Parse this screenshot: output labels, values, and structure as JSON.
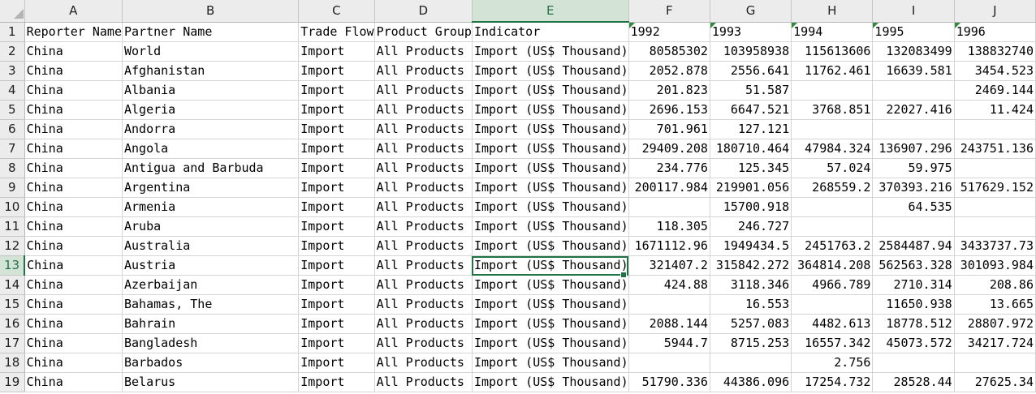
{
  "columns": [
    "A",
    "B",
    "C",
    "D",
    "E",
    "F",
    "G",
    "H",
    "I",
    "J"
  ],
  "selected_column": "E",
  "selected_row": "13",
  "rows": [
    {
      "n": "1",
      "a": "Reporter Name",
      "b": "Partner Name",
      "c": "Trade Flow",
      "d": "Product Group",
      "e": "Indicator",
      "f": "1992",
      "g": "1993",
      "h": "1994",
      "i": "1995",
      "j": "1996"
    },
    {
      "n": "2",
      "a": "China",
      "b": " World",
      "c": "Import",
      "d": " All Products",
      "e": "Import (US$ Thousand)",
      "f": "80585302",
      "g": "103958938",
      "h": "115613606",
      "i": "132083499",
      "j": "138832740"
    },
    {
      "n": "3",
      "a": "China",
      "b": "Afghanistan",
      "c": "Import",
      "d": " All Products",
      "e": "Import (US$ Thousand)",
      "f": "2052.878",
      "g": "2556.641",
      "h": "11762.461",
      "i": "16639.581",
      "j": "3454.523"
    },
    {
      "n": "4",
      "a": "China",
      "b": "Albania",
      "c": "Import",
      "d": " All Products",
      "e": "Import (US$ Thousand)",
      "f": "201.823",
      "g": "51.587",
      "h": "",
      "i": "",
      "j": "2469.144"
    },
    {
      "n": "5",
      "a": "China",
      "b": "Algeria",
      "c": "Import",
      "d": " All Products",
      "e": "Import (US$ Thousand)",
      "f": "2696.153",
      "g": "6647.521",
      "h": "3768.851",
      "i": "22027.416",
      "j": "11.424"
    },
    {
      "n": "6",
      "a": "China",
      "b": "Andorra",
      "c": "Import",
      "d": " All Products",
      "e": "Import (US$ Thousand)",
      "f": "701.961",
      "g": "127.121",
      "h": "",
      "i": "",
      "j": ""
    },
    {
      "n": "7",
      "a": "China",
      "b": "Angola",
      "c": "Import",
      "d": " All Products",
      "e": "Import (US$ Thousand)",
      "f": "29409.208",
      "g": "180710.464",
      "h": "47984.324",
      "i": "136907.296",
      "j": "243751.136"
    },
    {
      "n": "8",
      "a": "China",
      "b": "Antigua and Barbuda",
      "c": "Import",
      "d": " All Products",
      "e": "Import (US$ Thousand)",
      "f": "234.776",
      "g": "125.345",
      "h": "57.024",
      "i": "59.975",
      "j": ""
    },
    {
      "n": "9",
      "a": "China",
      "b": "Argentina",
      "c": "Import",
      "d": " All Products",
      "e": "Import (US$ Thousand)",
      "f": "200117.984",
      "g": "219901.056",
      "h": "268559.2",
      "i": "370393.216",
      "j": "517629.152"
    },
    {
      "n": "10",
      "a": "China",
      "b": "Armenia",
      "c": "Import",
      "d": " All Products",
      "e": "Import (US$ Thousand)",
      "f": "",
      "g": "15700.918",
      "h": "",
      "i": "64.535",
      "j": ""
    },
    {
      "n": "11",
      "a": "China",
      "b": "Aruba",
      "c": "Import",
      "d": " All Products",
      "e": "Import (US$ Thousand)",
      "f": "118.305",
      "g": "246.727",
      "h": "",
      "i": "",
      "j": ""
    },
    {
      "n": "12",
      "a": "China",
      "b": "Australia",
      "c": "Import",
      "d": " All Products",
      "e": "Import (US$ Thousand)",
      "f": "1671112.96",
      "g": "1949434.5",
      "h": "2451763.2",
      "i": "2584487.94",
      "j": "3433737.73"
    },
    {
      "n": "13",
      "a": "China",
      "b": "Austria",
      "c": "Import",
      "d": " All Products",
      "e": "Import (US$ Thousand)",
      "f": "321407.2",
      "g": "315842.272",
      "h": "364814.208",
      "i": "562563.328",
      "j": "301093.984"
    },
    {
      "n": "14",
      "a": "China",
      "b": "Azerbaijan",
      "c": "Import",
      "d": " All Products",
      "e": "Import (US$ Thousand)",
      "f": "424.88",
      "g": "3118.346",
      "h": "4966.789",
      "i": "2710.314",
      "j": "208.86"
    },
    {
      "n": "15",
      "a": "China",
      "b": "Bahamas, The",
      "c": "Import",
      "d": " All Products",
      "e": "Import (US$ Thousand)",
      "f": "",
      "g": "16.553",
      "h": "",
      "i": "11650.938",
      "j": "13.665"
    },
    {
      "n": "16",
      "a": "China",
      "b": "Bahrain",
      "c": "Import",
      "d": " All Products",
      "e": "Import (US$ Thousand)",
      "f": "2088.144",
      "g": "5257.083",
      "h": "4482.613",
      "i": "18778.512",
      "j": "28807.972"
    },
    {
      "n": "17",
      "a": "China",
      "b": "Bangladesh",
      "c": "Import",
      "d": " All Products",
      "e": "Import (US$ Thousand)",
      "f": "5944.7",
      "g": "8715.253",
      "h": "16557.342",
      "i": "45073.572",
      "j": "34217.724"
    },
    {
      "n": "18",
      "a": "China",
      "b": "Barbados",
      "c": "Import",
      "d": " All Products",
      "e": "Import (US$ Thousand)",
      "f": "",
      "g": "",
      "h": "2.756",
      "i": "",
      "j": ""
    },
    {
      "n": "19",
      "a": "China",
      "b": "Belarus",
      "c": "Import",
      "d": " All Products",
      "e": "Import (US$ Thousand)",
      "f": "51790.336",
      "g": "44386.096",
      "h": "17254.732",
      "i": "28528.44",
      "j": "27625.34"
    }
  ]
}
